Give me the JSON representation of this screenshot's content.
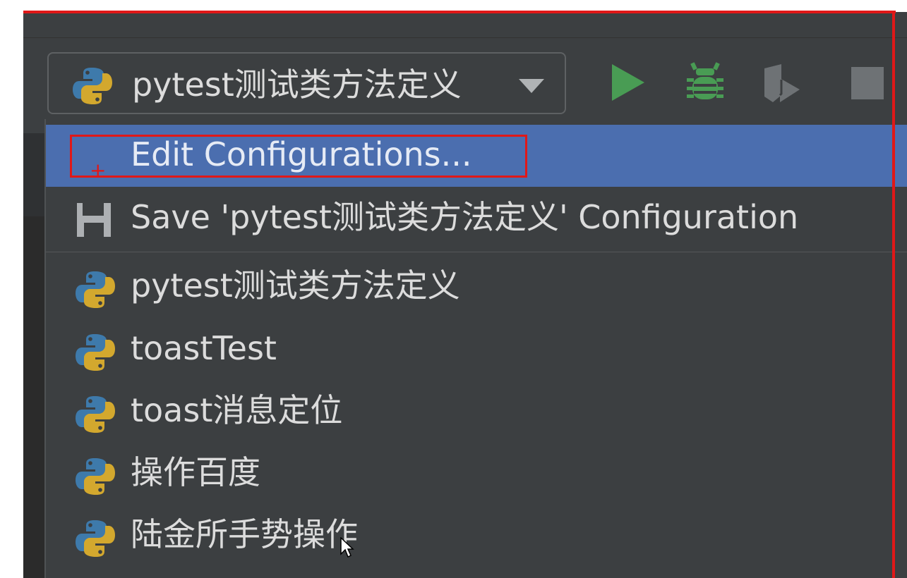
{
  "toolbar": {
    "config_selector": {
      "label": "pytest测试类方法定义",
      "icon": "python-icon"
    },
    "run": {
      "icon": "play-icon",
      "color": "#499c54"
    },
    "debug": {
      "icon": "bug-icon",
      "color": "#499c54"
    },
    "coverage": {
      "icon": "coverage-icon"
    },
    "stop": {
      "icon": "stop-icon"
    }
  },
  "dropdown": {
    "actions": [
      {
        "label": "Edit Configurations...",
        "icon": "edit-configurations-icon",
        "selected": true
      },
      {
        "label": "Save 'pytest测试类方法定义' Configuration",
        "icon": "save-icon"
      }
    ],
    "configurations": [
      {
        "label": "pytest测试类方法定义",
        "icon": "python-icon"
      },
      {
        "label": "toastTest",
        "icon": "python-icon"
      },
      {
        "label": "toast消息定位",
        "icon": "python-icon"
      },
      {
        "label": "操作百度",
        "icon": "python-icon"
      },
      {
        "label": "陆金所手势操作",
        "icon": "python-icon"
      }
    ]
  },
  "annotation": {
    "color": "#e01818"
  },
  "colors": {
    "background": "#3c3f41",
    "selection": "#4b6eaf",
    "text": "#dcdcdc"
  }
}
